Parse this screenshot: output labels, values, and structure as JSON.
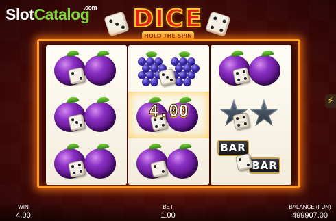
{
  "brand": {
    "part1": "Slot",
    "part2": "Catalog",
    "suffix": ".com"
  },
  "logo": {
    "title": "DICE",
    "subtitle": "HOLD THE SPIN"
  },
  "reels": [
    [
      "plum",
      "plum",
      "plum"
    ],
    [
      "grapes",
      "plum",
      "plum"
    ],
    [
      "plum",
      "star",
      "bar"
    ]
  ],
  "win_overlay": {
    "reel": 1,
    "row": 1,
    "amount": "4.00"
  },
  "bar_label": "BAR",
  "side_icon": "lightning-icon",
  "stats": {
    "win": {
      "label": "WIN",
      "value": "4.00"
    },
    "bet": {
      "label": "BET",
      "value": "1.00"
    },
    "balance": {
      "label": "BALANCE (FUN)",
      "value": "499907.00"
    }
  },
  "colors": {
    "frame": "#ff9a1a",
    "brand_accent": "#7fd83a",
    "logo_red": "#e0201c"
  }
}
